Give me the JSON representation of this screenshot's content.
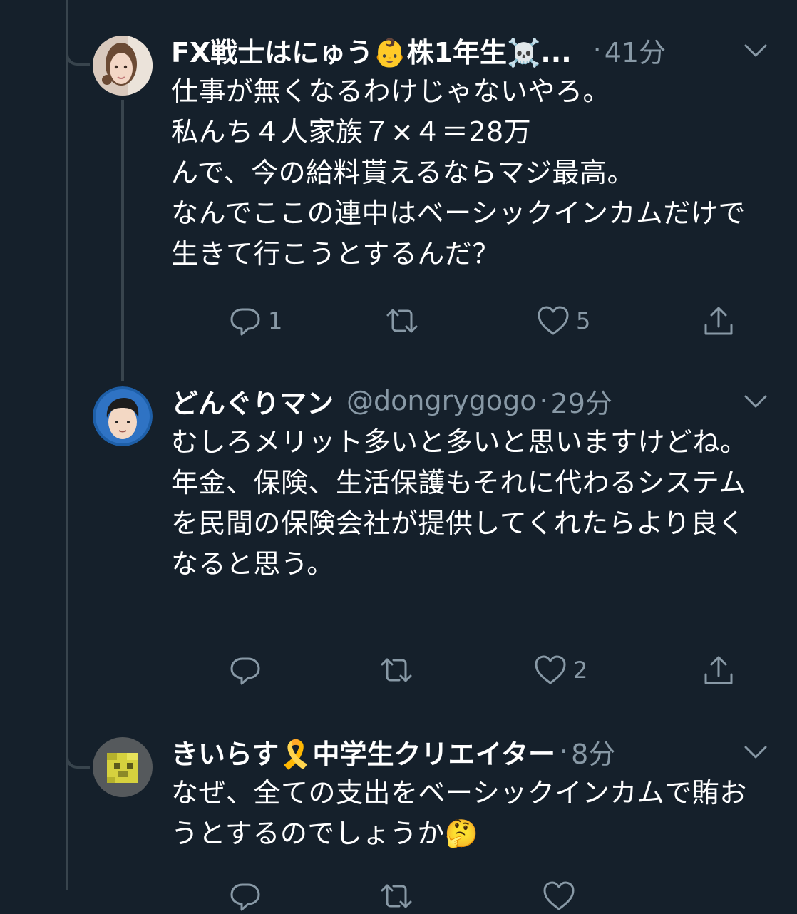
{
  "tweets": [
    {
      "name": "FX戦士はにゅう👶株1年生☠️...",
      "handle": "",
      "dot": "·",
      "time": "41分",
      "text": "仕事が無くなるわけじゃないやろ。\n私んち４人家族７×４＝28万\nんで、今の給料貰えるならマジ最高。\nなんでここの連中はベーシックインカムだけで生きて行こうとするんだ？",
      "reply_count": "1",
      "retweet_count": "",
      "like_count": "5"
    },
    {
      "name": "どんぐりマン",
      "handle": "@dongrygogo",
      "dot": "·",
      "time": "29分",
      "text": "むしろメリット多いと多いと思いますけどね。\n年金、保険、生活保護もそれに代わるシステムを民間の保険会社が提供してくれたらより良くなると思う。",
      "reply_count": "",
      "retweet_count": "",
      "like_count": "2"
    },
    {
      "name": "きいらす🎗️中学生クリエイター",
      "handle": "",
      "dot": "·",
      "time": "8分",
      "text": "なぜ、全ての支出をベーシックインカムで賄おうとするのでしょうか🤔",
      "reply_count": "",
      "retweet_count": "",
      "like_count": ""
    }
  ],
  "colors": {
    "background": "#15202b",
    "muted": "#8899a6",
    "line": "#38444d",
    "text": "#ffffff"
  },
  "icons": [
    "reply-icon",
    "retweet-icon",
    "like-icon",
    "share-icon",
    "chevron-down-icon"
  ]
}
